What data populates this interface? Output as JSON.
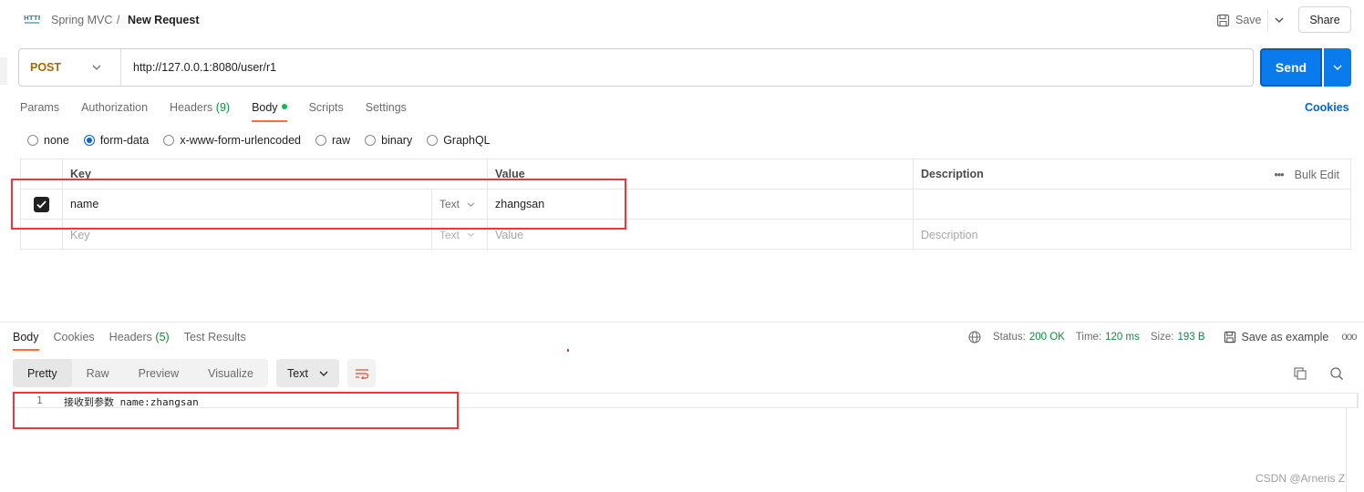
{
  "header": {
    "collection": "Spring MVC",
    "separator": "/",
    "request_name": "New Request",
    "save_label": "Save",
    "share_label": "Share"
  },
  "request": {
    "method": "POST",
    "url": "http://127.0.0.1:8080/user/r1",
    "send_label": "Send"
  },
  "tabs": {
    "params": "Params",
    "authorization": "Authorization",
    "headers": "Headers",
    "headers_count": "(9)",
    "body": "Body",
    "scripts": "Scripts",
    "settings": "Settings",
    "cookies": "Cookies"
  },
  "body_types": {
    "none": "none",
    "form_data": "form-data",
    "urlencoded": "x-www-form-urlencoded",
    "raw": "raw",
    "binary": "binary",
    "graphql": "GraphQL",
    "selected": "form-data"
  },
  "table": {
    "headers": {
      "key": "Key",
      "value": "Value",
      "description": "Description",
      "bulk_edit": "Bulk Edit"
    },
    "rows": [
      {
        "key": "name",
        "type": "Text",
        "value": "zhangsan",
        "description": ""
      }
    ],
    "placeholder": {
      "key": "Key",
      "type": "Text",
      "value": "Value",
      "description": "Description"
    }
  },
  "response": {
    "tabs": {
      "body": "Body",
      "cookies": "Cookies",
      "headers": "Headers",
      "headers_count": "(5)",
      "tests": "Test Results"
    },
    "status_label": "Status:",
    "status_value": "200 OK",
    "time_label": "Time:",
    "time_value": "120 ms",
    "size_label": "Size:",
    "size_value": "193 B",
    "save_example": "Save as example",
    "views": {
      "pretty": "Pretty",
      "raw": "Raw",
      "preview": "Preview",
      "visualize": "Visualize"
    },
    "format": "Text",
    "line_number": "1",
    "body_text": "接收到参数 name:zhangsan"
  },
  "watermark": "CSDN @Arneris Z",
  "colors": {
    "accent": "#ff6c37",
    "send": "#097bed",
    "status_ok": "#0c8c3c",
    "method_post": "#a46a00",
    "highlight_box": "#e8383d"
  }
}
